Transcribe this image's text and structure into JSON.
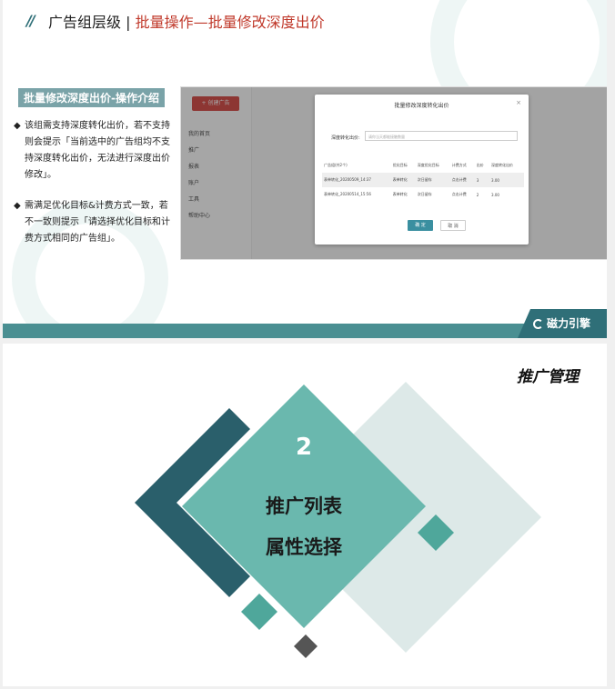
{
  "slide1": {
    "header_prefix": "广告组层级 | ",
    "header_highlight": "批量操作—批量修改深度出价",
    "section_label": "批量修改深度出价-操作介绍",
    "bullet_symbol": "◆",
    "bullets": [
      "该组需支持深度转化出价，若不支持则会提示「当前选中的广告组均不支持深度转化出价，无法进行深度出价修改」。",
      "需满足优化目标&计费方式一致，若不一致则提示「请选择优化目标和计费方式相同的广告组」。"
    ],
    "screenshot": {
      "new_button": "+ 创建广告",
      "sidebar": [
        "我的首页",
        "推广",
        "报表",
        "账户",
        "工具",
        "帮助中心"
      ],
      "dialog": {
        "title": "批量修改深度转化出价",
        "close": "×",
        "field_label": "深度转化出价:",
        "placeholder": "请你当天都能接触数量",
        "columns": [
          "广告组(共2个)",
          "优化目标",
          "深度优化目标",
          "计费方式",
          "出价",
          "深度转化出价"
        ],
        "rows": [
          [
            "表单转化_20200509_14:37",
            "表单转化",
            "次日留存",
            "点击计费",
            "3",
            "3.00"
          ],
          [
            "表单转化_20200514_15:56",
            "表单转化",
            "次日留存",
            "点击计费",
            "2",
            "3.00"
          ]
        ],
        "ok": "确 定",
        "cancel": "取 消"
      }
    },
    "logo": "磁力引擎"
  },
  "slide2": {
    "title": "推广管理",
    "number": "2",
    "line1": "推广列表",
    "line2": "属性选择"
  },
  "colors": {
    "teal_dark": "#2a5f6b",
    "teal_mid": "#6ab8ae",
    "teal_light": "#dde9e8",
    "red": "#c0392b"
  }
}
